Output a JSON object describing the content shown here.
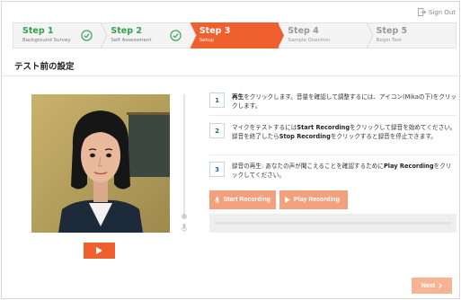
{
  "header": {
    "signout_label": "Sign Out"
  },
  "steps": [
    {
      "num": "Step 1",
      "sub": "Background Survey",
      "state": "done"
    },
    {
      "num": "Step 2",
      "sub": "Self Assessment",
      "state": "done"
    },
    {
      "num": "Step 3",
      "sub": "Setup",
      "state": "active"
    },
    {
      "num": "Step 4",
      "sub": "Sample Question",
      "state": "pending"
    },
    {
      "num": "Step 5",
      "sub": "Begin Test",
      "state": "pending"
    }
  ],
  "page": {
    "title": "テスト前の設定"
  },
  "instructions": [
    {
      "badge": "1",
      "before": "",
      "bold1": "再生",
      "middle": "をクリックします。音量を確認して調整するには、アイコン(Mikaの下)をクリックします。",
      "bold2": "",
      "after": ""
    },
    {
      "badge": "2",
      "before": "マイクをテストするには",
      "bold1": "Start Recording",
      "middle": "をクリックして録音を始めてください。録音を終了したら",
      "bold2": "Stop Recording",
      "after": "をクリックすると録音を停止できます。"
    },
    {
      "badge": "3",
      "before": "録音の再生: あなたの声が聞こえることを確認するために",
      "bold1": "Play Recording",
      "middle": "をクリックしてください。",
      "bold2": "",
      "after": ""
    }
  ],
  "buttons": {
    "start_recording": "Start Recording",
    "play_recording": "Play Recording",
    "next": "Next"
  },
  "playback": {
    "progress": 0
  },
  "colors": {
    "accent": "#f0602f",
    "accent_light": "#f3a07e",
    "done_green": "#31a24c"
  },
  "icons": {
    "signout": "sign-out-icon",
    "check": "check-circle-icon",
    "play": "play-icon",
    "mic": "microphone-icon",
    "next": "chevron-right-icon"
  }
}
